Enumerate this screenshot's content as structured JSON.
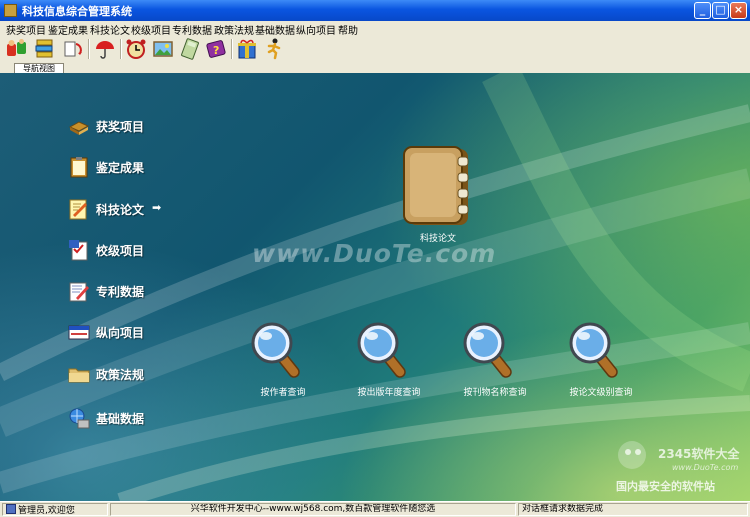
{
  "window": {
    "title": "科技信息综合管理系统"
  },
  "menu": [
    "获奖项目",
    "鉴定成果",
    "科技论文",
    "校级项目",
    "专利数据",
    "政策法规",
    "基础数据",
    "纵向项目",
    "帮助"
  ],
  "toolbar": {
    "icons": [
      "users-exchange-icon",
      "book-stack-icon",
      "refresh-arrows-icon",
      "umbrella-icon",
      "alarm-clock-icon",
      "picture-icon",
      "calculator-icon",
      "help-book-icon",
      "gift-box-icon",
      "running-man-icon"
    ]
  },
  "tabs": [
    {
      "label": "导航视图"
    }
  ],
  "nav": [
    {
      "label": "获奖项目",
      "icon": "award-book-icon"
    },
    {
      "label": "鉴定成果",
      "icon": "clipboard-icon"
    },
    {
      "label": "科技论文",
      "icon": "paper-pen-icon",
      "active": true
    },
    {
      "label": "校级项目",
      "icon": "checklist-icon"
    },
    {
      "label": "专利数据",
      "icon": "notepad-pencil-icon"
    },
    {
      "label": "纵向项目",
      "icon": "window-form-icon"
    },
    {
      "label": "政策法规",
      "icon": "folder-icon"
    },
    {
      "label": "基础数据",
      "icon": "database-globe-icon"
    }
  ],
  "nav_arrow": "➡",
  "main": {
    "feature_label": "科技论文",
    "watermark": "www.DuoTe.com",
    "queries": [
      "按作者查询",
      "按出版年度查询",
      "按刊物名称查询",
      "按论文级别查询"
    ]
  },
  "corner_watermark": {
    "brand": "2345软件大全",
    "url": "www.DuoTe.com",
    "slogan": "国内最安全的软件站"
  },
  "status": {
    "user": "管理员,欢迎您",
    "center": "兴华软件开发中心--www.wj568.com,数百款管理软件随您选",
    "right": "对话框请求数据完成"
  },
  "colors": {
    "title_bar": "#0a55e0",
    "chrome": "#ece9d8",
    "desktop_bg": "#11566f"
  }
}
